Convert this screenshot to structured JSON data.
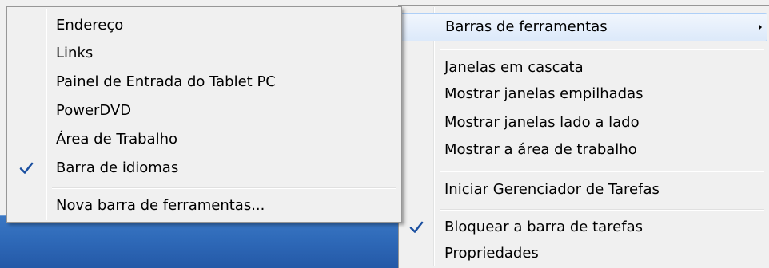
{
  "toolbars_submenu": {
    "items": [
      {
        "label": "Endereço",
        "checked": false
      },
      {
        "label": "Links",
        "checked": false
      },
      {
        "label": "Painel de Entrada do Tablet PC",
        "checked": false
      },
      {
        "label": "PowerDVD",
        "checked": false
      },
      {
        "label": "Área de Trabalho",
        "checked": false
      },
      {
        "label": "Barra de idiomas",
        "checked": true
      }
    ],
    "new_toolbar_label": "Nova barra de ferramentas..."
  },
  "context_menu": {
    "toolbars_label": "Barras de ferramentas",
    "cascade_label": "Janelas em cascata",
    "stacked_label": "Mostrar janelas empilhadas",
    "side_by_side_label": "Mostrar janelas lado a lado",
    "show_desktop_label": "Mostrar a área de trabalho",
    "task_manager_label": "Iniciar Gerenciador de Tarefas",
    "lock_taskbar_label": "Bloquear a barra de tarefas",
    "lock_taskbar_checked": true,
    "properties_label": "Propriedades"
  },
  "colors": {
    "check_mark": "#1a4fa0",
    "menu_background": "#f0f0f0",
    "highlight": "#dce9fa",
    "desktop": "#2f6ab9"
  },
  "icons": {
    "check": "check-icon",
    "submenu_arrow": "chevron-right-icon"
  }
}
